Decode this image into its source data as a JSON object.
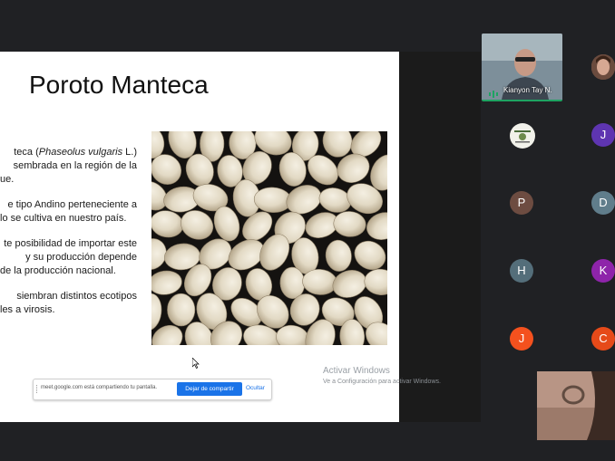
{
  "slide": {
    "title": "Poroto Manteca",
    "line1_a": "teca  (",
    "line1_italic": "Phaseolus vulgaris",
    "line1_b": " L.)",
    "line2": "sembrada en la región de la",
    "line3": "ue.",
    "line4": "e tipo Andino perteneciente a",
    "line5": "lo se cultiva en nuestro país.",
    "line6": "te posibilidad de importar este",
    "line7": "y  su  producción  depende",
    "line8": "de la producción nacional.",
    "line9": "siembran  distintos  ecotipos",
    "line10": "les a virosis."
  },
  "share_bar": {
    "text": "meet.google.com está compartiendo tu pantalla.",
    "stop_label": "Dejar de compartir",
    "hide_label": "Ocultar"
  },
  "watermark": {
    "title": "Activar Windows",
    "subtitle": "Ve a Configuración para activar Windows."
  },
  "participants": {
    "featured_name": "Kianyon Tay N.",
    "avatars": [
      {
        "letter": "J",
        "color": "#5e35b1"
      },
      {
        "letter": "P",
        "color": "#6d4c41"
      },
      {
        "letter": "D",
        "color": "#607d8b"
      },
      {
        "letter": "H",
        "color": "#546e7a"
      },
      {
        "letter": "K",
        "color": "#8e24aa"
      },
      {
        "letter": "J",
        "color": "#f4511e"
      },
      {
        "letter": "C",
        "color": "#e64a19"
      }
    ]
  },
  "colors": {
    "speaking_border": "#1ea362",
    "share_button": "#1a73e8"
  }
}
